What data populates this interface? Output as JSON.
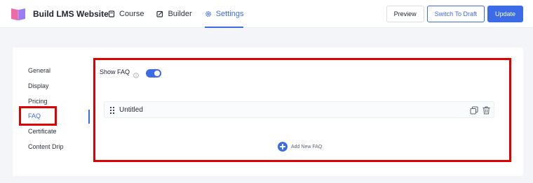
{
  "app": {
    "title": "Build LMS Website",
    "logo": "book-logo-icon"
  },
  "nav": [
    {
      "label": "Course",
      "icon": "course-icon",
      "active": false
    },
    {
      "label": "Builder",
      "icon": "builder-icon",
      "active": false
    },
    {
      "label": "Settings",
      "icon": "gear-icon",
      "active": true
    }
  ],
  "actions": {
    "preview": "Preview",
    "draft": "Switch To Draft",
    "update": "Update"
  },
  "sidebar": {
    "items": [
      {
        "label": "General"
      },
      {
        "label": "Display"
      },
      {
        "label": "Pricing"
      },
      {
        "label": "FAQ",
        "active": true
      },
      {
        "label": "Certificate"
      },
      {
        "label": "Content Drip"
      }
    ]
  },
  "faq": {
    "toggle_label": "Show FAQ",
    "toggle_on": true,
    "items": [
      {
        "title": "Untitled"
      }
    ],
    "add_label": "Add New FAQ"
  },
  "colors": {
    "accent": "#3c6be8",
    "highlight": "#e00000"
  }
}
